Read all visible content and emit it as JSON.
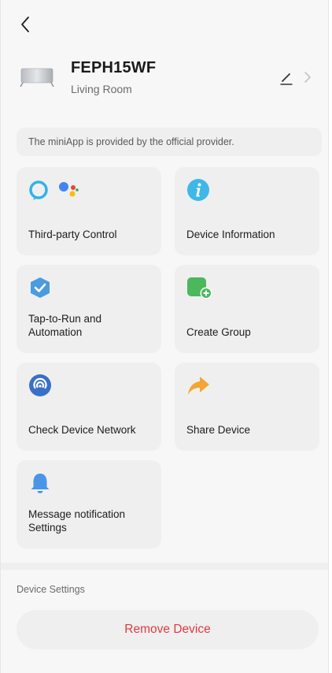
{
  "device": {
    "name": "FEPH15WF",
    "room": "Living Room"
  },
  "provider_note": "The miniApp is provided by the official provider.",
  "cards": [
    {
      "label": "Third-party Control",
      "icon": "alexa-google-assistant-icon"
    },
    {
      "label": "Device Information",
      "icon": "info-icon"
    },
    {
      "label": "Tap-to-Run and\nAutomation",
      "icon": "automation-check-icon"
    },
    {
      "label": "Create Group",
      "icon": "create-group-icon"
    },
    {
      "label": "Check Device Network",
      "icon": "network-signal-icon"
    },
    {
      "label": "Share Device",
      "icon": "share-arrow-icon"
    },
    {
      "label": "Message notification\nSettings",
      "icon": "bell-icon"
    }
  ],
  "device_settings_label": "Device Settings",
  "remove_device_label": "Remove Device",
  "colors": {
    "background": "#f7f7f7",
    "card": "#efefef",
    "danger": "#e0393e",
    "info_blue": "#3fb7e8",
    "automation_blue": "#4a9be0",
    "group_green": "#4cb85c",
    "network_blue": "#3a6fc7",
    "share_orange": "#f4a532",
    "bell_blue": "#4a95e8"
  }
}
